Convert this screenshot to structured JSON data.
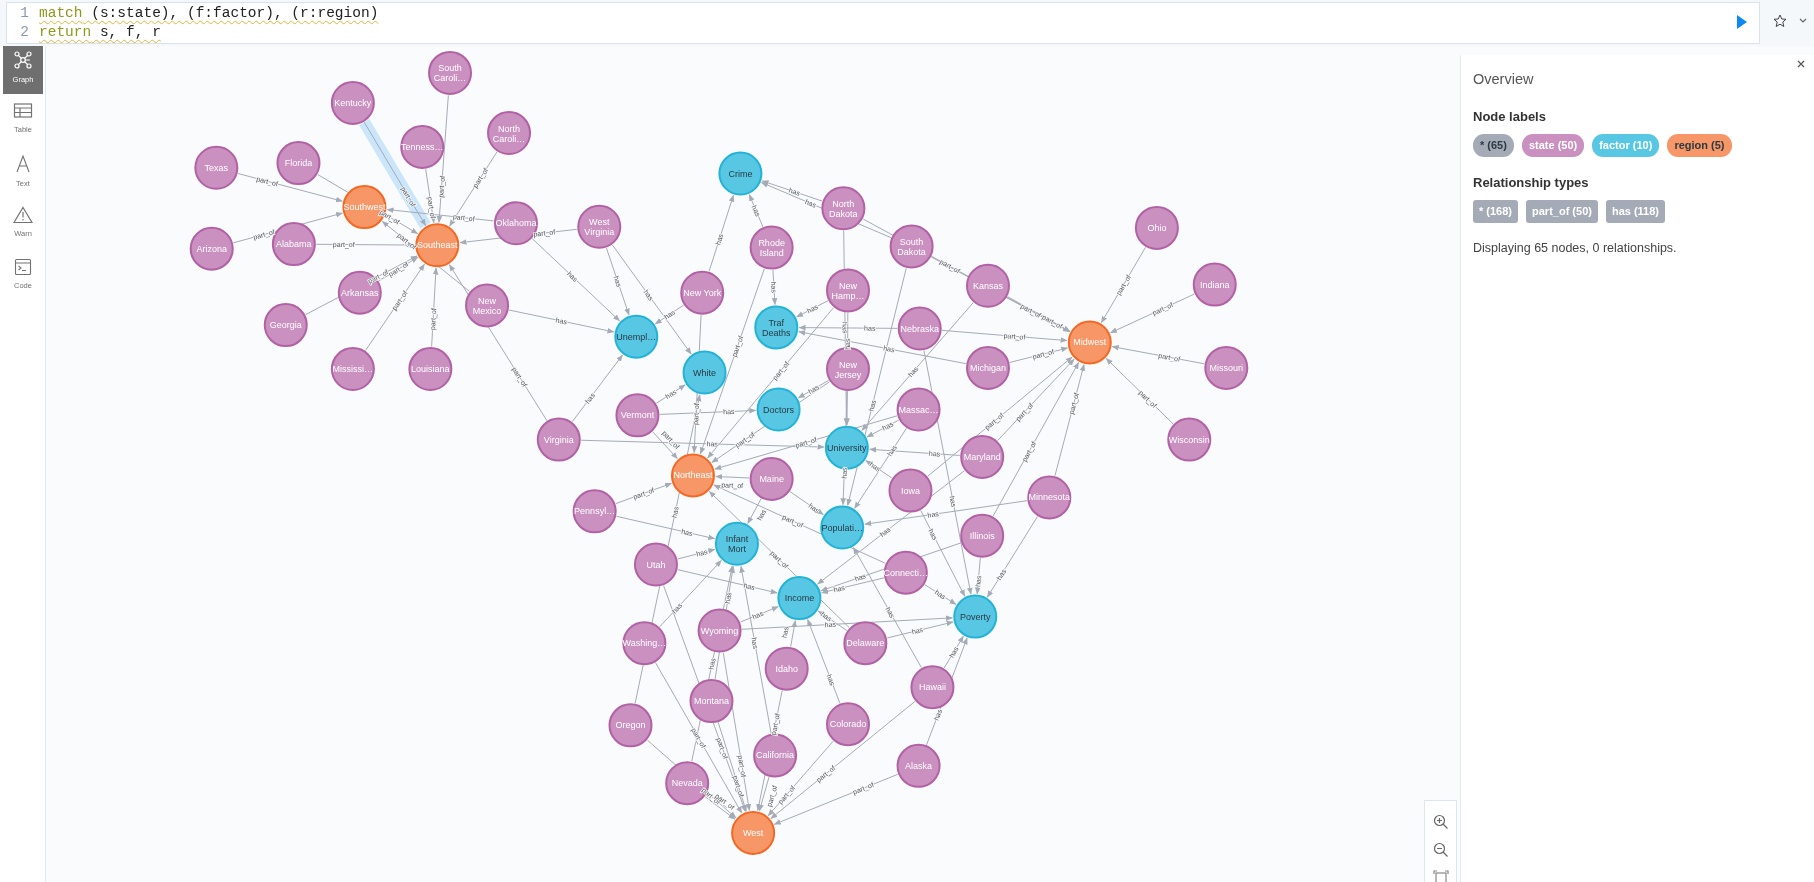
{
  "editor": {
    "lines": [
      {
        "number": "1",
        "tokens": [
          {
            "kind": "keyword",
            "text": "match"
          },
          {
            "kind": "plain",
            "text": " (s:state), (f:factor), (r:region)"
          }
        ]
      },
      {
        "number": "2",
        "tokens": [
          {
            "kind": "keyword",
            "text": "return"
          },
          {
            "kind": "plain",
            "text": " s, f, r"
          }
        ]
      }
    ]
  },
  "sidebar": {
    "items": [
      {
        "label": "Graph",
        "selected": true
      },
      {
        "label": "Table",
        "selected": false
      },
      {
        "label": "Text",
        "selected": false
      },
      {
        "label": "Warn",
        "selected": false
      },
      {
        "label": "Code",
        "selected": false
      }
    ]
  },
  "graph": {
    "nodes": [
      {
        "kind": "state",
        "label": "South Caroli…"
      },
      {
        "kind": "state",
        "label": "Kentucky"
      },
      {
        "kind": "state",
        "label": "North Caroli…"
      },
      {
        "kind": "state",
        "label": "Tenness…"
      },
      {
        "kind": "state",
        "label": "Texas"
      },
      {
        "kind": "state",
        "label": "Florida"
      },
      {
        "kind": "factor",
        "label": "Crime"
      },
      {
        "kind": "region",
        "label": "Southwest"
      },
      {
        "kind": "state",
        "label": "North Dakota"
      },
      {
        "kind": "state",
        "label": "Oklahoma"
      },
      {
        "kind": "state",
        "label": "West Virginia"
      },
      {
        "kind": "state",
        "label": "Ohio"
      },
      {
        "kind": "state",
        "label": "Arizona"
      },
      {
        "kind": "state",
        "label": "Alabama"
      },
      {
        "kind": "region",
        "label": "Southeast"
      },
      {
        "kind": "state",
        "label": "Rhode Island"
      },
      {
        "kind": "state",
        "label": "South Dakota"
      },
      {
        "kind": "state",
        "label": "Arkansas"
      },
      {
        "kind": "state",
        "label": "New York"
      },
      {
        "kind": "state",
        "label": "New Hamp…"
      },
      {
        "kind": "state",
        "label": "Kansas"
      },
      {
        "kind": "state",
        "label": "Indiana"
      },
      {
        "kind": "state",
        "label": "New Mexico"
      },
      {
        "kind": "state",
        "label": "Georgia"
      },
      {
        "kind": "factor",
        "label": "Traf Deaths"
      },
      {
        "kind": "state",
        "label": "Nebraska"
      },
      {
        "kind": "factor",
        "label": "Unempl…"
      },
      {
        "kind": "region",
        "label": "Midwest"
      },
      {
        "kind": "state",
        "label": "Mississi…"
      },
      {
        "kind": "state",
        "label": "Louisiana"
      },
      {
        "kind": "factor",
        "label": "White"
      },
      {
        "kind": "state",
        "label": "New Jersey"
      },
      {
        "kind": "state",
        "label": "Michigan"
      },
      {
        "kind": "state",
        "label": "Missouri"
      },
      {
        "kind": "state",
        "label": "Vermont"
      },
      {
        "kind": "factor",
        "label": "Doctors"
      },
      {
        "kind": "state",
        "label": "Massac…"
      },
      {
        "kind": "state",
        "label": "Virginia"
      },
      {
        "kind": "factor",
        "label": "University"
      },
      {
        "kind": "state",
        "label": "Wisconsin"
      },
      {
        "kind": "state",
        "label": "Maryland"
      },
      {
        "kind": "region",
        "label": "Northeast"
      },
      {
        "kind": "state",
        "label": "Maine"
      },
      {
        "kind": "state",
        "label": "Iowa"
      },
      {
        "kind": "state",
        "label": "Minnesota"
      },
      {
        "kind": "state",
        "label": "Pennsyl…"
      },
      {
        "kind": "factor",
        "label": "Populati…"
      },
      {
        "kind": "state",
        "label": "Illinois"
      },
      {
        "kind": "factor",
        "label": "Infant Mort"
      },
      {
        "kind": "state",
        "label": "Utah"
      },
      {
        "kind": "state",
        "label": "Connecti…"
      },
      {
        "kind": "factor",
        "label": "Income"
      },
      {
        "kind": "factor",
        "label": "Poverty"
      },
      {
        "kind": "state",
        "label": "Wyoming"
      },
      {
        "kind": "state",
        "label": "Washing…"
      },
      {
        "kind": "state",
        "label": "Delaware"
      },
      {
        "kind": "state",
        "label": "Idaho"
      },
      {
        "kind": "state",
        "label": "Hawaii"
      },
      {
        "kind": "state",
        "label": "Montana"
      },
      {
        "kind": "state",
        "label": "Oregon"
      },
      {
        "kind": "state",
        "label": "Colorado"
      },
      {
        "kind": "state",
        "label": "California"
      },
      {
        "kind": "state",
        "label": "Alaska"
      },
      {
        "kind": "state",
        "label": "Nevada"
      },
      {
        "kind": "region",
        "label": "West"
      }
    ],
    "relationships": [
      {
        "label": "part_of",
        "selected": false
      },
      {
        "label": "part_of",
        "selected": true
      },
      {
        "label": "part_of",
        "selected": false
      },
      {
        "label": "part_of",
        "selected": false
      },
      {
        "label": "part_of",
        "selected": false
      },
      {
        "label": "part_of",
        "selected": false
      },
      {
        "label": "part_of",
        "selected": false
      },
      {
        "label": "part_of",
        "selected": false
      },
      {
        "label": "part_of",
        "selected": false
      },
      {
        "label": "part_of",
        "selected": false
      },
      {
        "label": "part_of",
        "selected": false
      },
      {
        "label": "part_of",
        "selected": false
      },
      {
        "label": "part_of",
        "selected": false
      },
      {
        "label": "part_of",
        "selected": false
      },
      {
        "label": "part_of",
        "selected": false
      },
      {
        "label": "part_of",
        "selected": false
      },
      {
        "label": "part_of",
        "selected": false
      },
      {
        "label": "part_of",
        "selected": false
      },
      {
        "label": "part_of",
        "selected": false
      },
      {
        "label": "part_of",
        "selected": false
      },
      {
        "label": "part_of",
        "selected": false
      },
      {
        "label": "part_of",
        "selected": false
      },
      {
        "label": "part_of",
        "selected": false
      },
      {
        "label": "part_of",
        "selected": false
      },
      {
        "label": "part_of",
        "selected": false
      },
      {
        "label": "part_of",
        "selected": false
      },
      {
        "label": "part_of",
        "selected": false
      },
      {
        "label": "part_of",
        "selected": false
      },
      {
        "label": "part_of",
        "selected": false
      },
      {
        "label": "part_of",
        "selected": false
      },
      {
        "label": "part_of",
        "selected": false
      },
      {
        "label": "part_of",
        "selected": false
      },
      {
        "label": "part_of",
        "selected": false
      },
      {
        "label": "part_of",
        "selected": false
      },
      {
        "label": "part_of",
        "selected": false
      },
      {
        "label": "part_of",
        "selected": false
      },
      {
        "label": "part_of",
        "selected": false
      },
      {
        "label": "part_of",
        "selected": false
      },
      {
        "label": "part_of",
        "selected": false
      },
      {
        "label": "part_of",
        "selected": false
      },
      {
        "label": "part_of",
        "selected": false
      },
      {
        "label": "part_of",
        "selected": false
      },
      {
        "label": "part_of",
        "selected": false
      },
      {
        "label": "part_of",
        "selected": false
      },
      {
        "label": "part_of",
        "selected": false
      },
      {
        "label": "part_of",
        "selected": false
      },
      {
        "label": "part_of",
        "selected": false
      },
      {
        "label": "part_of",
        "selected": false
      },
      {
        "label": "part_of",
        "selected": false
      },
      {
        "label": "part_of",
        "selected": false
      },
      {
        "label": "has",
        "selected": false
      },
      {
        "label": "has",
        "selected": false
      },
      {
        "label": "has",
        "selected": false
      },
      {
        "label": "has",
        "selected": false
      },
      {
        "label": "has",
        "selected": false
      },
      {
        "label": "has",
        "selected": false
      },
      {
        "label": "has",
        "selected": false
      },
      {
        "label": "has",
        "selected": false
      },
      {
        "label": "has",
        "selected": false
      },
      {
        "label": "has",
        "selected": false
      },
      {
        "label": "has",
        "selected": false
      },
      {
        "label": "has",
        "selected": false
      },
      {
        "label": "has",
        "selected": false
      },
      {
        "label": "has",
        "selected": false
      },
      {
        "label": "has",
        "selected": false
      },
      {
        "label": "has",
        "selected": false
      },
      {
        "label": "has",
        "selected": false
      },
      {
        "label": "has",
        "selected": false
      },
      {
        "label": "has",
        "selected": false
      },
      {
        "label": "has",
        "selected": false
      },
      {
        "label": "has",
        "selected": false
      },
      {
        "label": "has",
        "selected": false
      },
      {
        "label": "has",
        "selected": false
      },
      {
        "label": "has",
        "selected": false
      },
      {
        "label": "has",
        "selected": false
      },
      {
        "label": "has",
        "selected": false
      },
      {
        "label": "has",
        "selected": false
      },
      {
        "label": "has",
        "selected": false
      },
      {
        "label": "has",
        "selected": false
      },
      {
        "label": "has",
        "selected": false
      },
      {
        "label": "has",
        "selected": false
      },
      {
        "label": "has",
        "selected": false
      },
      {
        "label": "has",
        "selected": false
      },
      {
        "label": "has",
        "selected": false
      },
      {
        "label": "has",
        "selected": false
      },
      {
        "label": "has",
        "selected": false
      },
      {
        "label": "has",
        "selected": false
      },
      {
        "label": "has",
        "selected": false
      },
      {
        "label": "has",
        "selected": false
      },
      {
        "label": "has",
        "selected": false
      },
      {
        "label": "has",
        "selected": false
      },
      {
        "label": "has",
        "selected": false
      },
      {
        "label": "has",
        "selected": false
      },
      {
        "label": "has",
        "selected": false
      },
      {
        "label": "has",
        "selected": false
      },
      {
        "label": "has",
        "selected": false
      },
      {
        "label": "has",
        "selected": false
      },
      {
        "label": "has",
        "selected": false
      },
      {
        "label": "has",
        "selected": false
      },
      {
        "label": "has",
        "selected": false
      },
      {
        "label": "has",
        "selected": false
      },
      {
        "label": "has",
        "selected": false
      },
      {
        "label": "has",
        "selected": false
      },
      {
        "label": "has",
        "selected": false
      },
      {
        "label": "has",
        "selected": false
      }
    ]
  },
  "overview": {
    "title": "Overview",
    "node_labels_heading": "Node labels",
    "node_labels": [
      {
        "text": "* (65)",
        "color": "#a5abb6"
      },
      {
        "text": "state (50)",
        "color": "#c990c0"
      },
      {
        "text": "factor (10)",
        "color": "#57c7e3"
      },
      {
        "text": "region (5)",
        "color": "#f79767"
      }
    ],
    "relationship_types_heading": "Relationship types",
    "relationship_types": [
      {
        "text": "* (168)"
      },
      {
        "text": "part_of (50)"
      },
      {
        "text": "has (118)"
      }
    ],
    "summary": "Displaying 65 nodes, 0 relationships."
  }
}
